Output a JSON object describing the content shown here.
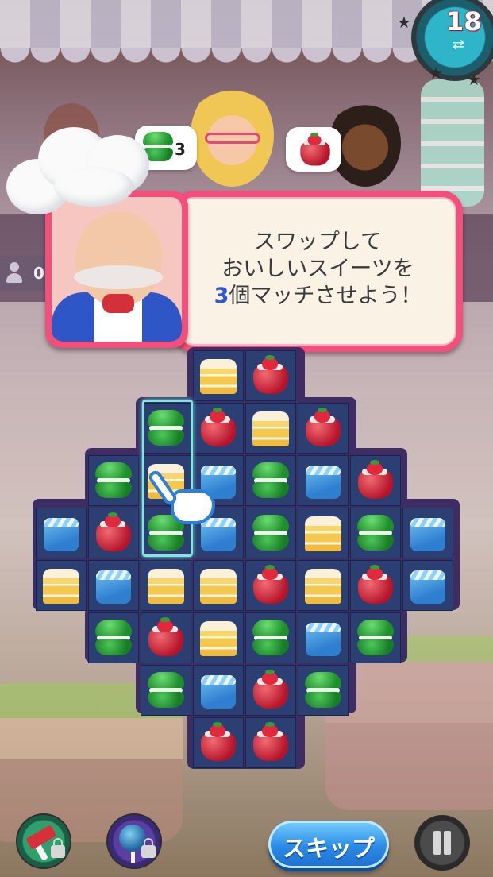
{
  "hud": {
    "moves_left": "18",
    "order_1_count": "3",
    "people_count": "0"
  },
  "tutorial": {
    "line1": "スワップして",
    "line2": "おいしいスイーツを",
    "line3_highlight": "3",
    "line3_rest": "個マッチさせよう！"
  },
  "buttons": {
    "skip_label": "スキップ"
  },
  "board": {
    "rows": [
      {
        "row": 0,
        "cells": [
          null,
          null,
          null,
          "cake",
          "jelly",
          null,
          null,
          null
        ]
      },
      {
        "row": 1,
        "cells": [
          null,
          null,
          "macaron",
          "jelly",
          "cake",
          "jelly",
          null,
          null
        ]
      },
      {
        "row": 2,
        "cells": [
          null,
          "macaron",
          "cake",
          "cube",
          "macaron",
          "cube",
          "jelly",
          null
        ]
      },
      {
        "row": 3,
        "cells": [
          "cube",
          "jelly",
          "macaron",
          "cube",
          "macaron",
          "cake",
          "macaron",
          "cube"
        ]
      },
      {
        "row": 4,
        "cells": [
          "cake",
          "cube",
          "cake",
          "cake",
          "jelly",
          "cake",
          "jelly",
          "cube"
        ]
      },
      {
        "row": 5,
        "cells": [
          null,
          "macaron",
          "jelly",
          "cake",
          "macaron",
          "cube",
          "macaron",
          null
        ]
      },
      {
        "row": 6,
        "cells": [
          null,
          null,
          "macaron",
          "cube",
          "jelly",
          "macaron",
          null,
          null
        ]
      },
      {
        "row": 7,
        "cells": [
          null,
          null,
          null,
          "jelly",
          "jelly",
          null,
          null,
          null
        ]
      }
    ]
  },
  "colors": {
    "panel_pink": "#f34f7a",
    "highlight_text": "#2b57d9",
    "skip_blue": "#2a8be5",
    "board_cell": "#2b3f73"
  },
  "icons": [
    "moves-swap-icon",
    "person-icon",
    "hammer-booster-icon",
    "cake-pop-booster-icon",
    "lock-icon",
    "pause-icon",
    "tutorial-hand-icon"
  ]
}
